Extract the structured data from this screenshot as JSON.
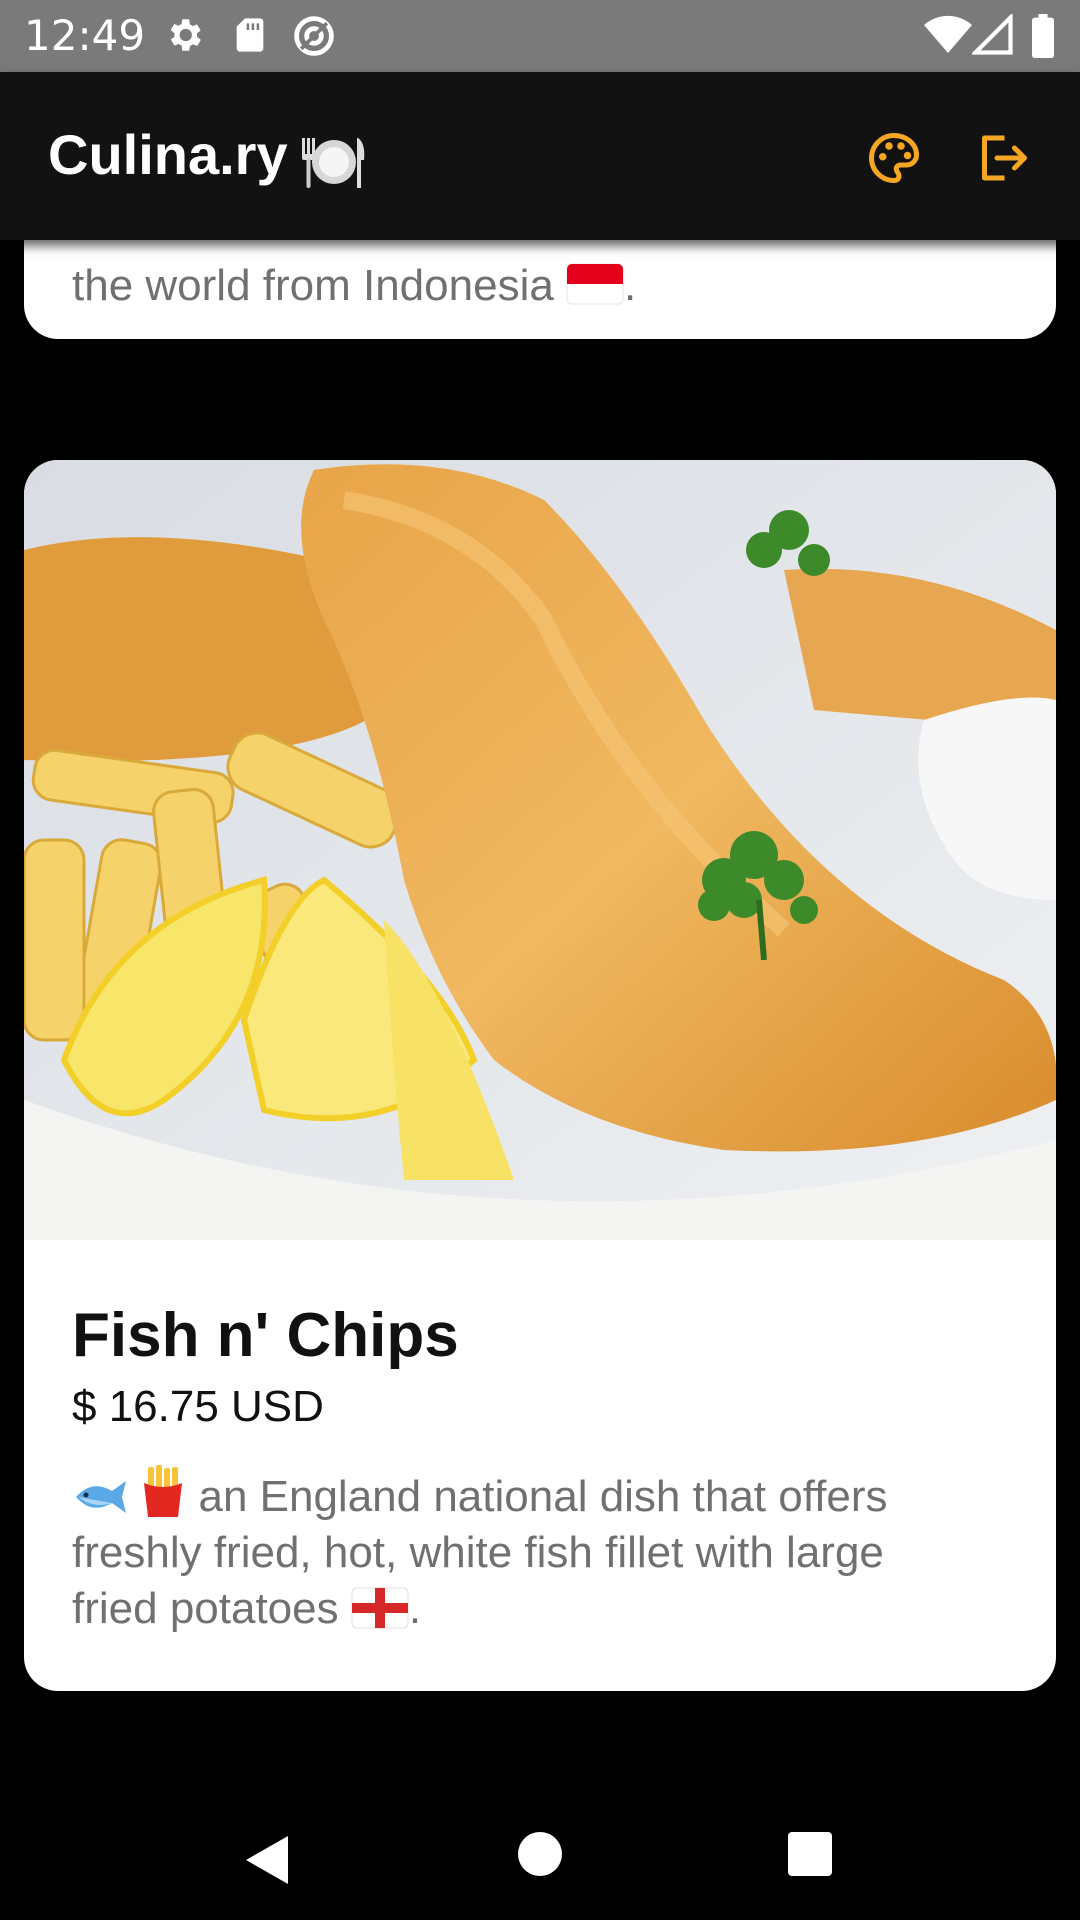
{
  "status_bar": {
    "time": "12:49",
    "icons": [
      "gear-icon",
      "sd-card-icon",
      "at-sign-icon",
      "wifi-icon",
      "signal-icon",
      "battery-icon"
    ]
  },
  "app_bar": {
    "title": "Culina.ry",
    "title_icon": "plate-cutlery-icon",
    "actions": [
      "palette-icon",
      "logout-icon"
    ],
    "accent_color": "#f5a623"
  },
  "cards": [
    {
      "description_visible": "the world from Indonesia",
      "flag": "flag-indonesia-icon",
      "trailing": "."
    },
    {
      "name": "Fish n' Chips",
      "price": "$ 16.75 USD",
      "description_line1": "an England national dish that offers",
      "description_line2": "freshly fried, hot, white fish fillet with large",
      "description_line3": "fried potatoes",
      "trailing": ".",
      "emoji_icons": [
        "fish-icon",
        "fries-icon",
        "flag-england-icon"
      ],
      "image": "fish-and-chips-photo"
    }
  ],
  "nav_bar": [
    "back-icon",
    "home-icon",
    "recents-icon"
  ]
}
